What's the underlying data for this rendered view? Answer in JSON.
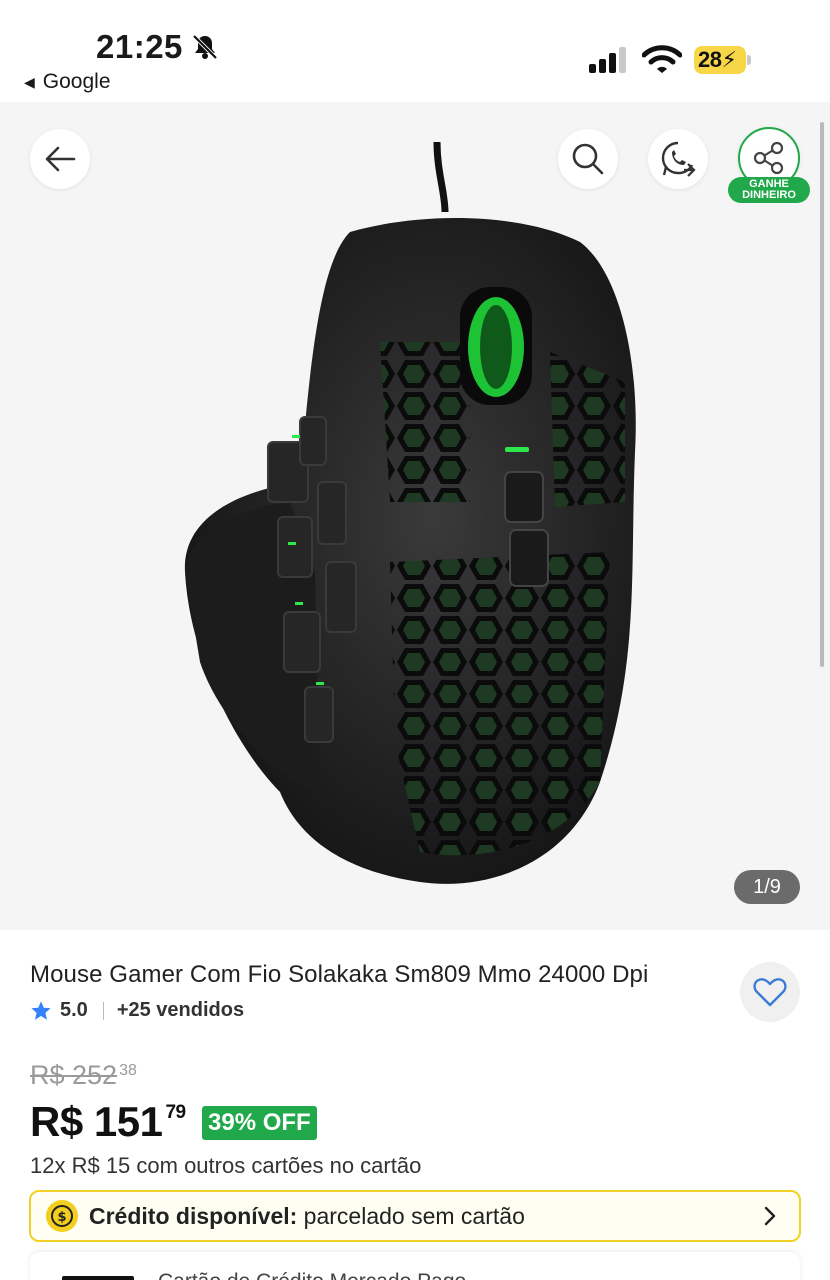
{
  "status_bar": {
    "time": "21:25",
    "back_app": "Google",
    "battery_level": "28"
  },
  "gallery": {
    "counter": "1/9",
    "earn_badge": "GANHE DINHEIRO",
    "colors": {
      "accent_green": "#20a84a",
      "background": "#f5f5f5"
    }
  },
  "product": {
    "title": "Mouse Gamer Com Fio Solakaka Sm809 Mmo 24000 Dpi",
    "rating": "5.0",
    "sold": "+25 vendidos",
    "old_price_int": "R$ 252",
    "old_price_cents": "38",
    "price_int": "R$ 151",
    "price_cents": "79",
    "discount": "39% OFF",
    "installments": "12x R$ 15 com outros cartões no cartão"
  },
  "credit": {
    "label": "Crédito disponível:",
    "text": " parcelado sem cartão",
    "border_color": "#f0d224"
  },
  "next_card": {
    "peek": "Cartão de Crédito Mercado Pago"
  },
  "icons": {
    "back": "arrow-left-icon",
    "search": "search-icon",
    "whatsapp": "whatsapp-icon",
    "share": "share-icon",
    "favorite": "heart-icon",
    "star": "star-icon",
    "coin": "coin-icon",
    "chevron": "chevron-right-icon"
  }
}
